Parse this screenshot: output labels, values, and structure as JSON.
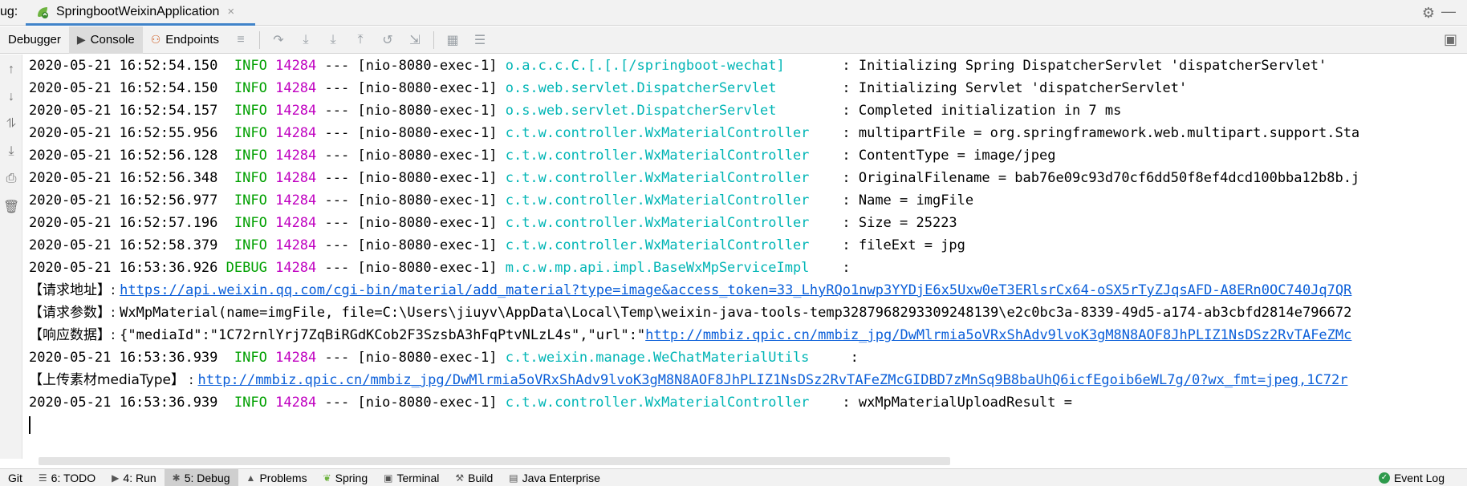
{
  "window": {
    "prefix": "ug:",
    "run_tab_title": "SpringbootWeixinApplication",
    "run_tab_close": "×"
  },
  "toolbar": {
    "debugger_label": "Debugger",
    "console_label": "Console",
    "endpoints_label": "Endpoints"
  },
  "colors": {
    "info": "#00a000",
    "pid": "#c000c0",
    "logger": "#00b5b5",
    "link": "#0b5fd9"
  },
  "console": {
    "lines": [
      {
        "ts": "2020-05-21 16:52:54.150",
        "level": " INFO",
        "pid": "14284",
        "sep": " --- ",
        "thread": "[nio-8080-exec-1]",
        "logger": "o.a.c.c.C.[.[.[/springboot-wechat]",
        "pad": "       ",
        "msg": ": Initializing Spring DispatcherServlet 'dispatcherServlet'"
      },
      {
        "ts": "2020-05-21 16:52:54.150",
        "level": " INFO",
        "pid": "14284",
        "sep": " --- ",
        "thread": "[nio-8080-exec-1]",
        "logger": "o.s.web.servlet.DispatcherServlet",
        "pad": "        ",
        "msg": ": Initializing Servlet 'dispatcherServlet'"
      },
      {
        "ts": "2020-05-21 16:52:54.157",
        "level": " INFO",
        "pid": "14284",
        "sep": " --- ",
        "thread": "[nio-8080-exec-1]",
        "logger": "o.s.web.servlet.DispatcherServlet",
        "pad": "        ",
        "msg": ": Completed initialization in 7 ms"
      },
      {
        "ts": "2020-05-21 16:52:55.956",
        "level": " INFO",
        "pid": "14284",
        "sep": " --- ",
        "thread": "[nio-8080-exec-1]",
        "logger": "c.t.w.controller.WxMaterialController",
        "pad": "    ",
        "msg": ": multipartFile = org.springframework.web.multipart.support.Sta"
      },
      {
        "ts": "2020-05-21 16:52:56.128",
        "level": " INFO",
        "pid": "14284",
        "sep": " --- ",
        "thread": "[nio-8080-exec-1]",
        "logger": "c.t.w.controller.WxMaterialController",
        "pad": "    ",
        "msg": ": ContentType = image/jpeg"
      },
      {
        "ts": "2020-05-21 16:52:56.348",
        "level": " INFO",
        "pid": "14284",
        "sep": " --- ",
        "thread": "[nio-8080-exec-1]",
        "logger": "c.t.w.controller.WxMaterialController",
        "pad": "    ",
        "msg": ": OriginalFilename = bab76e09c93d70cf6dd50f8ef4dcd100bba12b8b.j"
      },
      {
        "ts": "2020-05-21 16:52:56.977",
        "level": " INFO",
        "pid": "14284",
        "sep": " --- ",
        "thread": "[nio-8080-exec-1]",
        "logger": "c.t.w.controller.WxMaterialController",
        "pad": "    ",
        "msg": ": Name = imgFile"
      },
      {
        "ts": "2020-05-21 16:52:57.196",
        "level": " INFO",
        "pid": "14284",
        "sep": " --- ",
        "thread": "[nio-8080-exec-1]",
        "logger": "c.t.w.controller.WxMaterialController",
        "pad": "    ",
        "msg": ": Size = 25223"
      },
      {
        "ts": "2020-05-21 16:52:58.379",
        "level": " INFO",
        "pid": "14284",
        "sep": " --- ",
        "thread": "[nio-8080-exec-1]",
        "logger": "c.t.w.controller.WxMaterialController",
        "pad": "    ",
        "msg": ": fileExt = jpg"
      },
      {
        "ts": "2020-05-21 16:53:36.926",
        "level": "DEBUG",
        "pid": "14284",
        "sep": " --- ",
        "thread": "[nio-8080-exec-1]",
        "logger": "m.c.w.mp.api.impl.BaseWxMpServiceImpl",
        "pad": "    ",
        "msg": ":"
      }
    ],
    "req_addr_label": "【请求地址】: ",
    "req_addr_url": "https://api.weixin.qq.com/cgi-bin/material/add_material?type=image&access_token=33_LhyRQo1nwp3YYDjE6x5Uxw0eT3ERlsrCx64-oSX5rTyZJqsAFD-A8ERn0OC740Jq7QR",
    "req_params_label": "【请求参数】: ",
    "req_params_value": "WxMpMaterial(name=imgFile, file=C:\\Users\\jiuyv\\AppData\\Local\\Temp\\weixin-java-tools-temp3287968293309248139\\e2c0bc3a-8339-49d5-a174-ab3cbfd2814e796672",
    "resp_label": "【响应数据】: ",
    "resp_value_prefix": "{\"mediaId\":\"1C72rnlYrj7ZqBiRGdKCob2F3SzsbA3hFqPtvNLzL4s\",\"url\":\"",
    "resp_url": "http://mmbiz.qpic.cn/mmbiz_jpg/DwMlrmia5oVRxShAdv9lvoK3gM8N8AOF8JhPLIZ1NsDSz2RvTAFeZMc",
    "line_utils": {
      "ts": "2020-05-21 16:53:36.939",
      "level": " INFO",
      "pid": "14284",
      "sep": " --- ",
      "thread": "[nio-8080-exec-1]",
      "logger": "c.t.weixin.manage.WeChatMaterialUtils",
      "pad": "     ",
      "msg": ":"
    },
    "upload_label": "【上传素材mediaType】 : ",
    "upload_url": "http://mmbiz.qpic.cn/mmbiz_jpg/DwMlrmia5oVRxShAdv9lvoK3gM8N8AOF8JhPLIZ1NsDSz2RvTAFeZMcGIDBD7zMnSq9B8baUhQ6icfEgoib6eWL7g/0?wx_fmt=jpeg,1C72r",
    "line_result": {
      "ts": "2020-05-21 16:53:36.939",
      "level": " INFO",
      "pid": "14284",
      "sep": " --- ",
      "thread": "[nio-8080-exec-1]",
      "logger": "c.t.w.controller.WxMaterialController",
      "pad": "    ",
      "msg": ": wxMpMaterialUploadResult ="
    }
  },
  "statusbar": {
    "git": "Git",
    "todo": "6: TODO",
    "run": "4: Run",
    "debug": "5: Debug",
    "problems": "Problems",
    "spring": "Spring",
    "terminal": "Terminal",
    "build": "Build",
    "java_enterprise": "Java Enterprise",
    "event_log": "Event Log"
  }
}
